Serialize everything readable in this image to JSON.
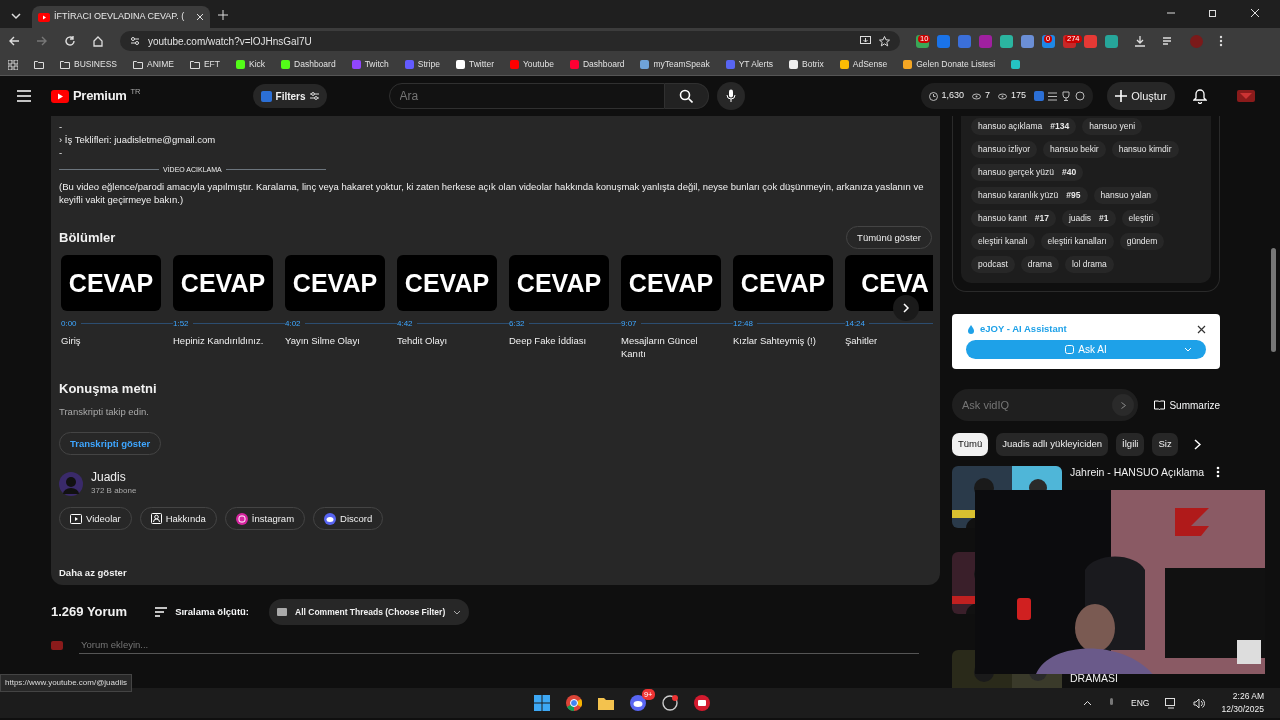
{
  "browser": {
    "tab_title": "İFTİRACI OEVLADINA CEVAP. (",
    "url": "youtube.com/watch?v=lOJHnsGal7U",
    "extensions": [
      {
        "color": "#3aa757",
        "badge": "10"
      },
      {
        "color": "#1a73e8"
      },
      {
        "color": "#3b6fd9"
      },
      {
        "color": "#a020a0"
      },
      {
        "color": "#2bb5a0"
      },
      {
        "color": "#6b8fd6"
      },
      {
        "color": "#1e88e5",
        "badge": "0"
      },
      {
        "color": "#c62828",
        "badge": "274"
      },
      {
        "color": "#e53935"
      },
      {
        "color": "#26a69a"
      }
    ],
    "bookmarks": [
      {
        "kind": "folder",
        "label": "BUSINESS"
      },
      {
        "kind": "folder",
        "label": "ANIME"
      },
      {
        "kind": "folder",
        "label": "EFT"
      },
      {
        "kind": "site",
        "label": "Kick",
        "color": "#53fc18"
      },
      {
        "kind": "site",
        "label": "Dashboard",
        "color": "#53fc18"
      },
      {
        "kind": "site",
        "label": "Twitch",
        "color": "#9146ff"
      },
      {
        "kind": "site",
        "label": "Stripe",
        "color": "#635bff"
      },
      {
        "kind": "site",
        "label": "Twitter",
        "color": "#ffffff"
      },
      {
        "kind": "site",
        "label": "Youtube",
        "color": "#ff0000"
      },
      {
        "kind": "site",
        "label": "Dashboard",
        "color": "#ff0033"
      },
      {
        "kind": "site",
        "label": "myTeamSpeak",
        "color": "#6fa3d8"
      },
      {
        "kind": "site",
        "label": "YT Alerts",
        "color": "#5865f2"
      },
      {
        "kind": "site",
        "label": "Botrix",
        "color": "#eeeeee"
      },
      {
        "kind": "site",
        "label": "AdSense",
        "color": "#fbbc04"
      },
      {
        "kind": "site",
        "label": "Gelen Donate Listesi",
        "color": "#f5a623"
      },
      {
        "kind": "site",
        "color": "#25c2c2"
      }
    ]
  },
  "header": {
    "logo": "Premium",
    "region": "TR",
    "filters": "Filters",
    "search_placeholder": "Ara",
    "stats": [
      "1,630",
      "7",
      "175"
    ],
    "create": "Oluştur"
  },
  "description": {
    "lines": [
      "-",
      "› İş Teklifleri: juadisletme@gmail.com",
      "-"
    ],
    "divider_label": "VİDEO ACIKLAMA",
    "paragraph": "(Bu video eğlence/parodi amacıyla yapılmıştır. Karalama, linç veya hakaret yoktur, ki zaten herkese açık olan videolar hakkında konuşmak yanlışta değil, neyse bunları çok düşünmeyin, arkanıza yaslanın ve keyifli vakit geçirmeye bakın.)"
  },
  "chapters": {
    "title": "Bölümler",
    "show_all": "Tümünü göster",
    "items": [
      {
        "thumb_text": "CEVAP",
        "time": "0:00",
        "title": "Giriş"
      },
      {
        "thumb_text": "CEVAP",
        "time": "1:52",
        "title": "Hepiniz Kandırıldınız."
      },
      {
        "thumb_text": "CEVAP",
        "time": "4:02",
        "title": "Yayın Silme Olayı"
      },
      {
        "thumb_text": "CEVAP",
        "time": "4:42",
        "title": "Tehdit Olayı"
      },
      {
        "thumb_text": "CEVAP",
        "time": "6:32",
        "title": "Deep Fake İddiası"
      },
      {
        "thumb_text": "CEVAP",
        "time": "9:07",
        "title": "Mesajların Güncel Kanıtı"
      },
      {
        "thumb_text": "CEVAP",
        "time": "12:48",
        "title": "Kızlar Sahteymiş (!)"
      },
      {
        "thumb_text": "CEVA",
        "time": "14:24",
        "title": "Şahitler"
      }
    ]
  },
  "transcript": {
    "title": "Konuşma metni",
    "subtitle": "Transkripti takip edin.",
    "button": "Transkripti göster"
  },
  "channel": {
    "name": "Juadis",
    "subscribers": "372 B abone",
    "links": [
      {
        "kind": "videos",
        "label": "Videolar"
      },
      {
        "kind": "about",
        "label": "Hakkında"
      },
      {
        "kind": "instagram",
        "label": "İnstagram"
      },
      {
        "kind": "discord",
        "label": "Discord"
      }
    ],
    "show_less": "Daha az göster"
  },
  "comments": {
    "count": "1.269 Yorum",
    "sort_label": "Sıralama ölçütü:",
    "filter": "All Comment Threads (Choose Filter)",
    "placeholder": "Yorum ekleyin..."
  },
  "status_url": "https://www.youtube.com/@juadiis",
  "tags": [
    {
      "label": "hansuo açıklama",
      "count": "#134"
    },
    {
      "label": "hansuo yeni"
    },
    {
      "label": "hansuo izliyor"
    },
    {
      "label": "hansuo bekir"
    },
    {
      "label": "hansuo kimdir"
    },
    {
      "label": "hansuo gerçek yüzü",
      "count": "#40"
    },
    {
      "label": "hansuo karanlık yüzü",
      "count": "#95"
    },
    {
      "label": "hansuo yalan"
    },
    {
      "label": "hansuo kanıt",
      "count": "#17"
    },
    {
      "label": "juadis",
      "count": "#1"
    },
    {
      "label": "eleştiri"
    },
    {
      "label": "eleştiri kanalı"
    },
    {
      "label": "eleştiri kanalları"
    },
    {
      "label": "gündem"
    },
    {
      "label": "podcast"
    },
    {
      "label": "drama"
    },
    {
      "label": "lol drama"
    }
  ],
  "ejoy": {
    "title": "eJOY - AI Assistant",
    "button": "Ask AI"
  },
  "vidiq": {
    "placeholder": "Ask vidIQ",
    "summarize": "Summarize"
  },
  "chips": [
    {
      "label": "Tümü",
      "selected": true
    },
    {
      "label": "Juadis adlı yükleyiciden",
      "selected": false
    },
    {
      "label": "İlgili",
      "selected": false
    },
    {
      "label": "Siz",
      "selected": false
    }
  ],
  "related": [
    {
      "kind": "video",
      "title": "Jahrein - HANSUO Açıklama"
    },
    {
      "kind": "video"
    },
    {
      "kind": "video",
      "title": "DRAMASI"
    }
  ],
  "taskbar": {
    "discord_badge": "9+",
    "language": "ENG",
    "time": "2:26 AM",
    "date": "12/30/2025"
  }
}
